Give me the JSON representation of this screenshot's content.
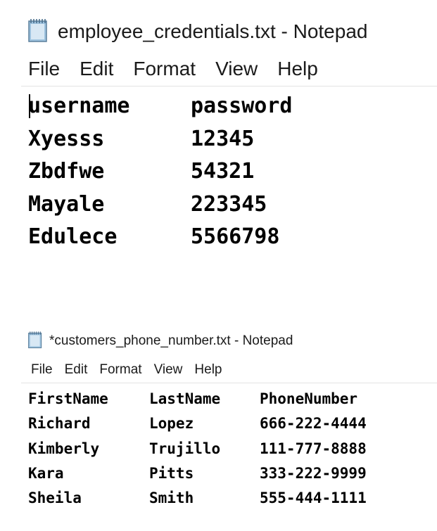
{
  "window1": {
    "title": "employee_credentials.txt - Notepad",
    "icon": "notepad-icon",
    "menu": [
      "File",
      "Edit",
      "Format",
      "View",
      "Help"
    ],
    "rows": [
      [
        "username",
        "password"
      ],
      [
        "Xyesss",
        "12345"
      ],
      [
        "Zbdfwe",
        "54321"
      ],
      [
        "Mayale",
        "223345"
      ],
      [
        "Edulece",
        "5566798"
      ]
    ]
  },
  "window2": {
    "title": "*customers_phone_number.txt - Notepad",
    "icon": "notepad-icon",
    "menu": [
      "File",
      "Edit",
      "Format",
      "View",
      "Help"
    ],
    "rows": [
      [
        "FirstName",
        "LastName",
        "PhoneNumber"
      ],
      [
        "Richard",
        "Lopez",
        "666-222-4444"
      ],
      [
        "Kimberly",
        "Trujillo",
        "111-777-8888"
      ],
      [
        "Kara",
        "Pitts",
        "333-222-9999"
      ],
      [
        "Sheila",
        "Smith",
        "555-444-1111"
      ]
    ]
  },
  "colors": {
    "icon_body": "#9ec3df",
    "icon_border": "#5b7f9c",
    "text": "#000000",
    "separator": "#e3e3e3"
  }
}
